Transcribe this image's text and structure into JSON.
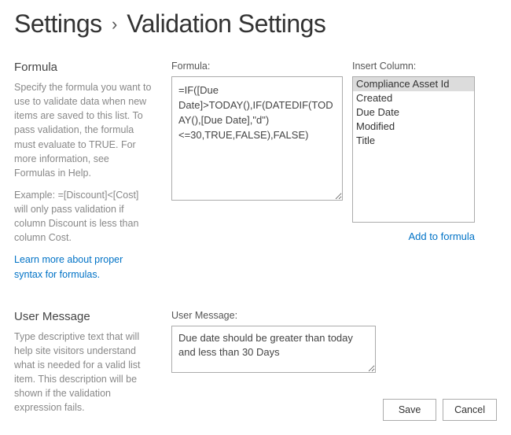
{
  "header": {
    "crumb1": "Settings",
    "crumb2": "Validation Settings"
  },
  "formula_section": {
    "title": "Formula",
    "desc1": "Specify the formula you want to use to validate data when new items are saved to this list. To pass validation, the formula must evaluate to TRUE. For more information, see Formulas in Help.",
    "desc2": "Example: =[Discount]<[Cost] will only pass validation if column Discount is less than column Cost.",
    "learn_link": "Learn more about proper syntax for formulas.",
    "formula_label": "Formula:",
    "formula_value": "=IF([Due Date]>TODAY(),IF(DATEDIF(TODAY(),[Due Date],\"d\")<=30,TRUE,FALSE),FALSE)",
    "insert_label": "Insert Column:",
    "columns": [
      "Compliance Asset Id",
      "Created",
      "Due Date",
      "Modified",
      "Title"
    ],
    "selected_column_index": 0,
    "add_link": "Add to formula"
  },
  "usermsg_section": {
    "title": "User Message",
    "desc": "Type descriptive text that will help site visitors understand what is needed for a valid list item. This description will be shown if the validation expression fails.",
    "label": "User Message:",
    "value": "Due date should be greater than today and less than 30 Days"
  },
  "buttons": {
    "save": "Save",
    "cancel": "Cancel"
  }
}
